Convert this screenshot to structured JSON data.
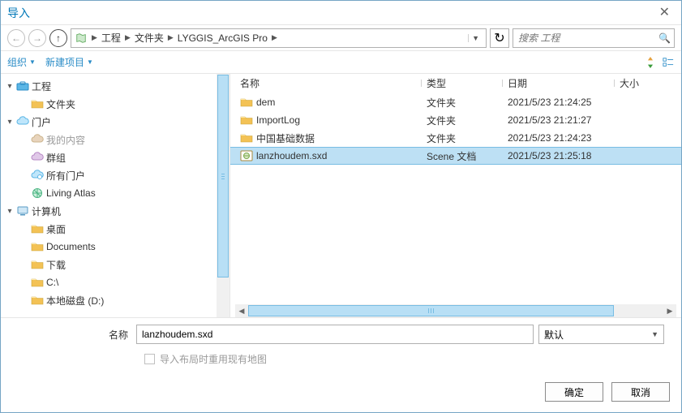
{
  "window": {
    "title": "导入",
    "close_icon_label": "✕"
  },
  "nav": {
    "back_icon": "←",
    "fwd_icon": "→",
    "up_icon": "↑",
    "refresh_icon": "↻",
    "breadcrumbs": [
      "工程",
      "文件夹",
      "LYGGIS_ArcGIS Pro"
    ],
    "search_placeholder": "搜索 工程"
  },
  "toolbar": {
    "organize": "组织",
    "new_item": "新建项目"
  },
  "tree": {
    "items": [
      {
        "label": "工程",
        "level": 0,
        "expander": "▾",
        "icon": "toolbox"
      },
      {
        "label": "文件夹",
        "level": 1,
        "expander": " ",
        "icon": "folder"
      },
      {
        "label": "门户",
        "level": 0,
        "expander": "▾",
        "icon": "cloud"
      },
      {
        "label": "我的内容",
        "level": 1,
        "expander": " ",
        "icon": "cloud-user",
        "muted": true
      },
      {
        "label": "群组",
        "level": 1,
        "expander": " ",
        "icon": "cloud-group"
      },
      {
        "label": "所有门户",
        "level": 1,
        "expander": " ",
        "icon": "cloud-all"
      },
      {
        "label": "Living Atlas",
        "level": 1,
        "expander": " ",
        "icon": "atlas"
      },
      {
        "label": "计算机",
        "level": 0,
        "expander": "▾",
        "icon": "computer"
      },
      {
        "label": "桌面",
        "level": 1,
        "expander": " ",
        "icon": "folder"
      },
      {
        "label": "Documents",
        "level": 1,
        "expander": " ",
        "icon": "folder"
      },
      {
        "label": "下载",
        "level": 1,
        "expander": " ",
        "icon": "folder"
      },
      {
        "label": "C:\\",
        "level": 1,
        "expander": " ",
        "icon": "folder"
      },
      {
        "label": "本地磁盘 (D:)",
        "level": 1,
        "expander": " ",
        "icon": "folder"
      }
    ]
  },
  "list": {
    "headers": {
      "name": "名称",
      "type": "类型",
      "date": "日期",
      "size": "大小"
    },
    "rows": [
      {
        "name": "dem",
        "type": "文件夹",
        "date": "2021/5/23 21:24:25",
        "icon": "folder",
        "selected": false
      },
      {
        "name": "ImportLog",
        "type": "文件夹",
        "date": "2021/5/23 21:21:27",
        "icon": "folder",
        "selected": false
      },
      {
        "name": "中国基础数据",
        "type": "文件夹",
        "date": "2021/5/23 21:24:23",
        "icon": "folder",
        "selected": false
      },
      {
        "name": "lanzhoudem.sxd",
        "type": "Scene 文档",
        "date": "2021/5/23 21:25:18",
        "icon": "scene",
        "selected": true
      }
    ]
  },
  "form": {
    "name_label": "名称",
    "name_value": "lanzhoudem.sxd",
    "type_value": "默认",
    "checkbox_label": "导入布局时重用现有地图",
    "ok": "确定",
    "cancel": "取消"
  },
  "colors": {
    "accent": "#0178b8",
    "selection_bg": "#bde0f4",
    "selection_border": "#78bde3"
  }
}
